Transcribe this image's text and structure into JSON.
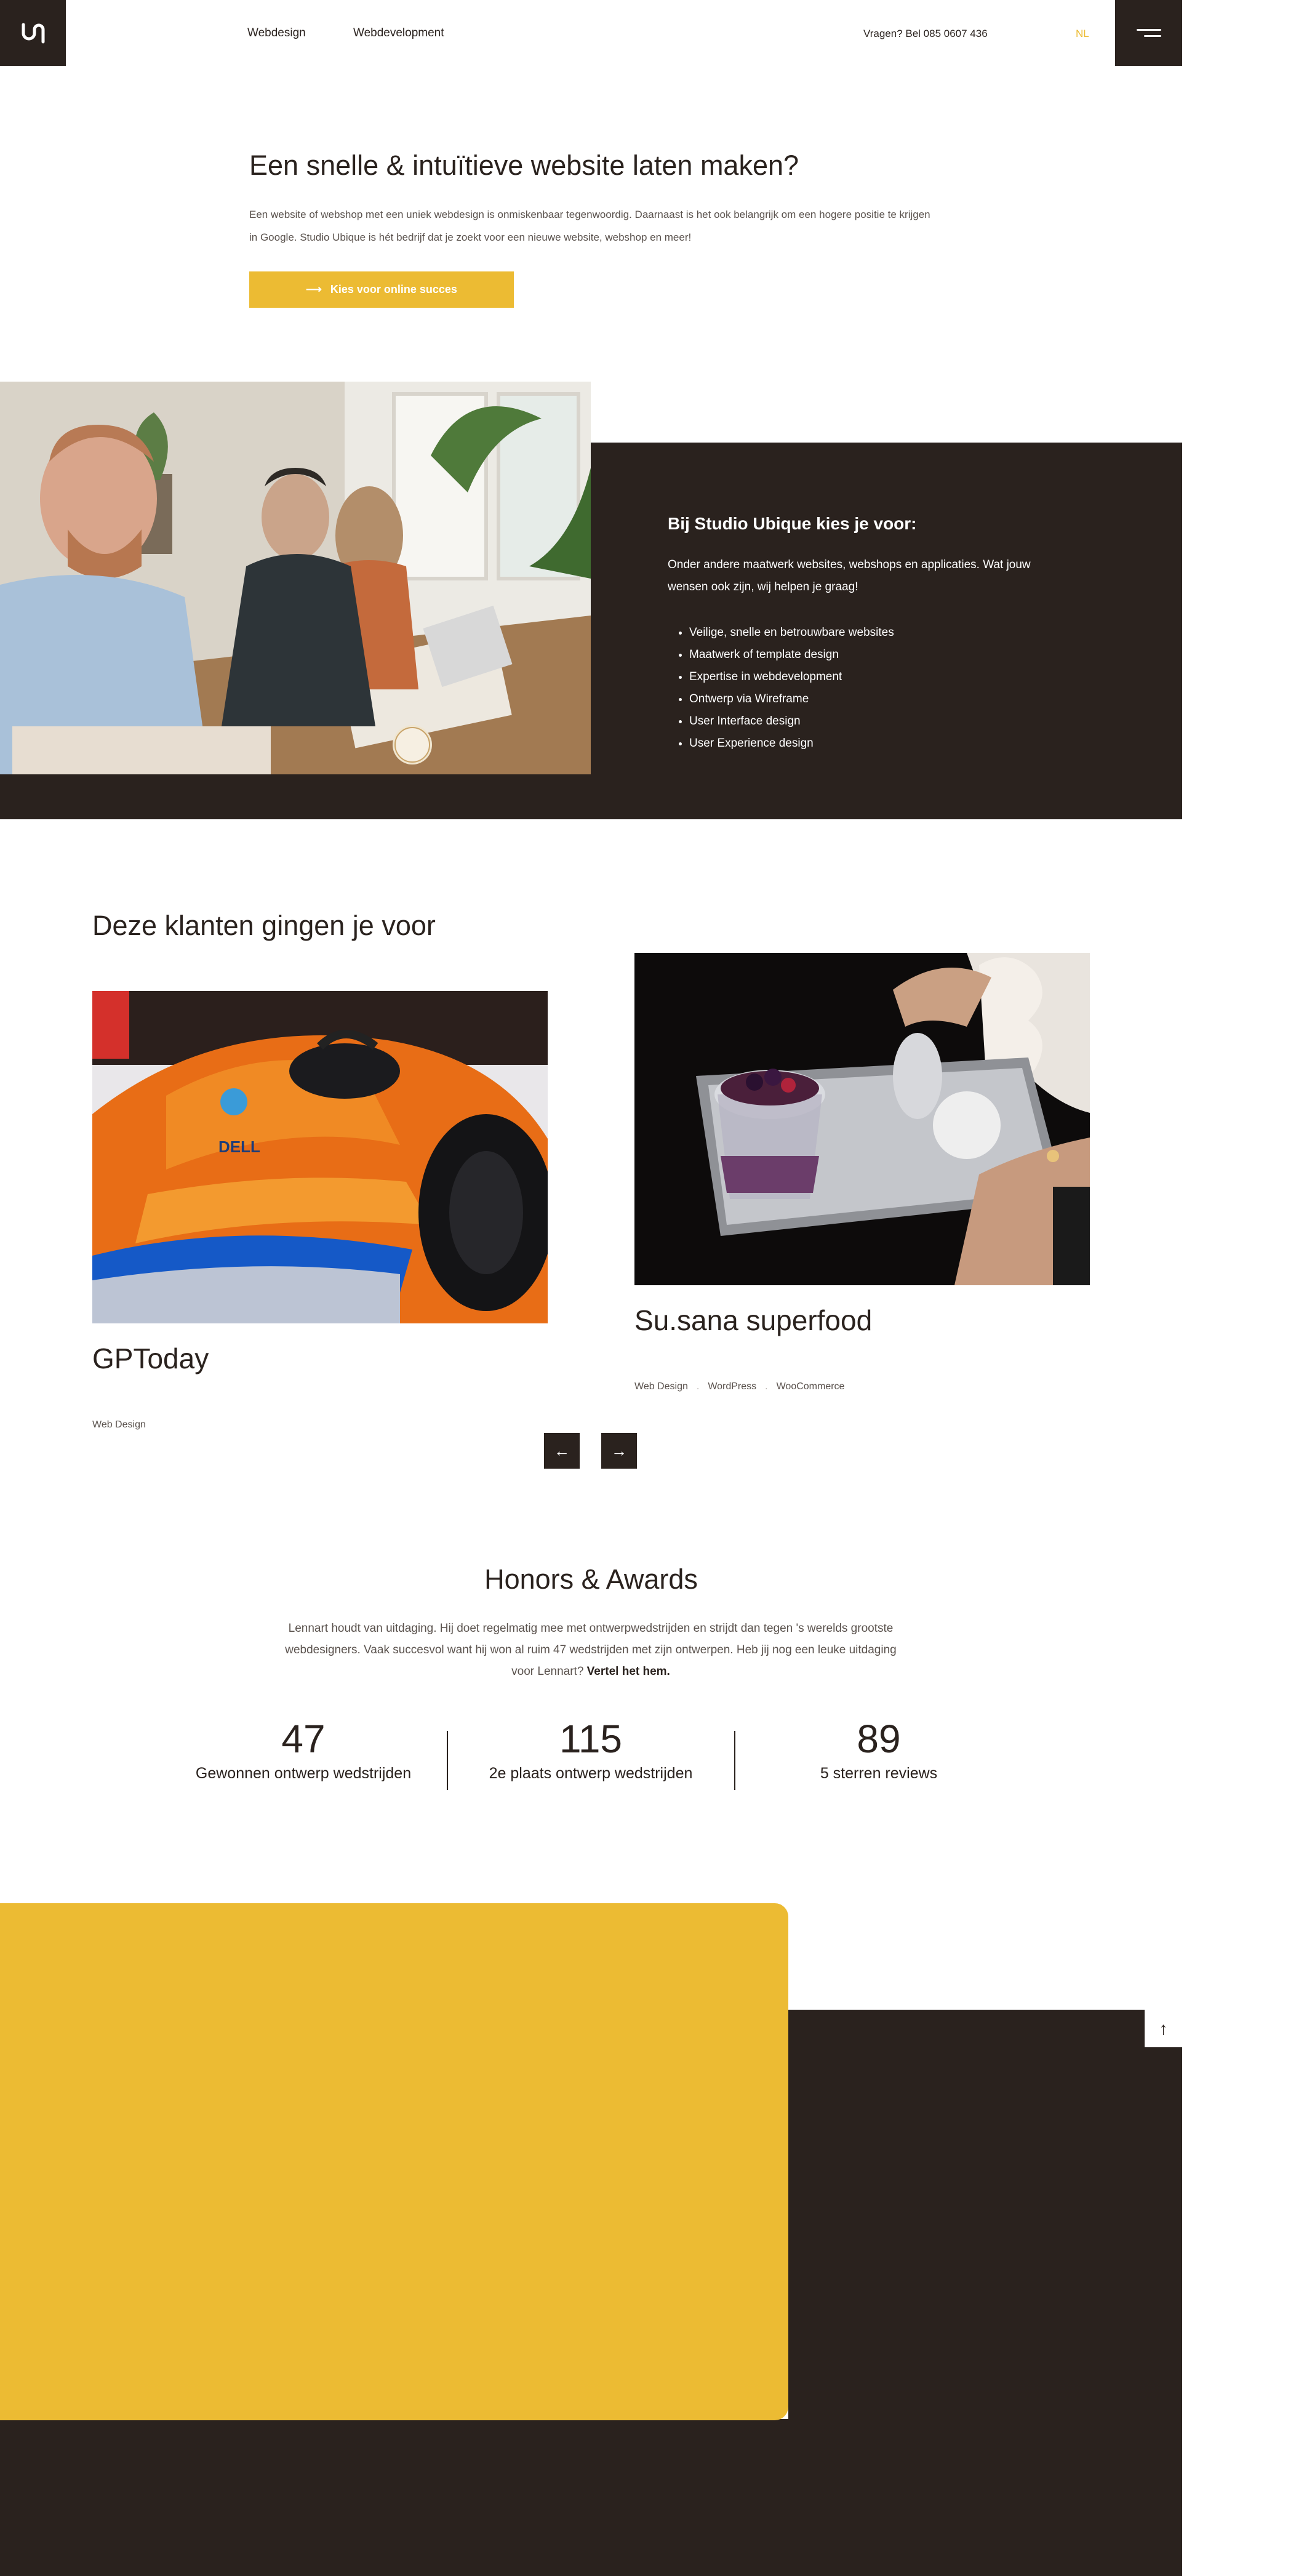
{
  "header": {
    "logo_text": "U",
    "nav": [
      {
        "label": "Webdesign"
      },
      {
        "label": "Webdevelopment"
      }
    ],
    "phone": "Vragen? Bel 085 0607 436",
    "language": "NL"
  },
  "hero": {
    "title": "Een snelle & intuïtieve website laten maken?",
    "text": "Een website of webshop met een uniek webdesign is onmiskenbaar tegenwoordig. Daarnaast is het ook belangrijk om een hogere positie te krijgen in Google. Studio Ubique is hét bedrijf dat je zoekt voor een nieuwe website, webshop en meer!",
    "cta_label": "Kies voor online succes"
  },
  "services": {
    "title": "Bij Studio Ubique kies je voor:",
    "text": "Onder andere maatwerk websites, webshops en applicaties. Wat jouw wensen ook zijn, wij helpen je graag!",
    "items": [
      "Veilige, snelle en betrouwbare websites",
      "Maatwerk of template design",
      "Expertise in webdevelopment",
      "Ontwerp via Wireframe",
      "User Interface design",
      "User Experience design"
    ]
  },
  "clients": {
    "title": "Deze klanten gingen je voor",
    "items": [
      {
        "name": "GPToday",
        "tags": [
          "Web Design"
        ]
      },
      {
        "name": "Su.sana superfood",
        "tags": [
          "Web Design",
          "WordPress",
          "WooCommerce"
        ]
      }
    ],
    "prev_icon": "←",
    "next_icon": "→"
  },
  "awards": {
    "title": "Honors & Awards",
    "text": "Lennart houdt van uitdaging. Hij doet regelmatig mee met ontwerpwedstrijden en strijdt dan tegen 's werelds grootste webdesigners. Vaak succesvol want hij won al ruim 47 wedstrijden met zijn ontwerpen. Heb jij nog een leuke uitdaging voor Lennart?",
    "link": "Vertel het hem.",
    "stats": [
      {
        "value": "47",
        "label": "Gewonnen ontwerp wedstrijden"
      },
      {
        "value": "115",
        "label": "2e plaats ontwerp wedstrijden"
      },
      {
        "value": "89",
        "label": "5 sterren reviews"
      }
    ]
  },
  "footer": {
    "to_top_icon": "↑"
  },
  "colors": {
    "dark": "#2a221e",
    "accent": "#ecbb33",
    "white": "#ffffff"
  }
}
